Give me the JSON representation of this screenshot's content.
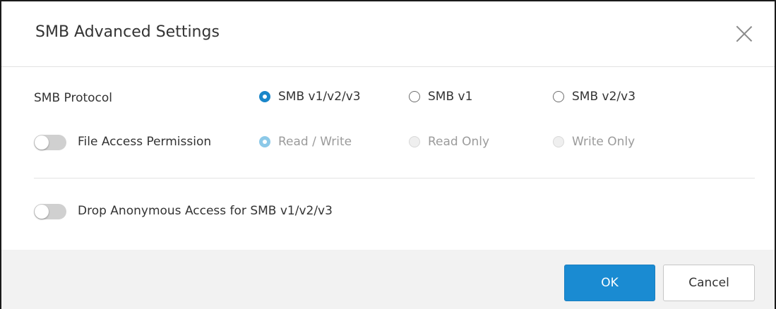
{
  "dialog": {
    "title": "SMB Advanced Settings",
    "close_icon": "close-icon"
  },
  "protocol": {
    "label": "SMB Protocol",
    "options": [
      {
        "label": "SMB v1/v2/v3",
        "checked": true
      },
      {
        "label": "SMB v1",
        "checked": false
      },
      {
        "label": "SMB v2/v3",
        "checked": false
      }
    ]
  },
  "file_access": {
    "label": "File Access Permission",
    "toggle_on": false,
    "options": [
      {
        "label": "Read / Write",
        "checked": true
      },
      {
        "label": "Read Only",
        "checked": false
      },
      {
        "label": "Write Only",
        "checked": false
      }
    ]
  },
  "anonymous": {
    "label": "Drop Anonymous Access for SMB v1/v2/v3",
    "toggle_on": false
  },
  "footer": {
    "ok_label": "OK",
    "cancel_label": "Cancel"
  },
  "colors": {
    "accent": "#1a8bd2",
    "footer_bg": "#f2f2f2"
  }
}
